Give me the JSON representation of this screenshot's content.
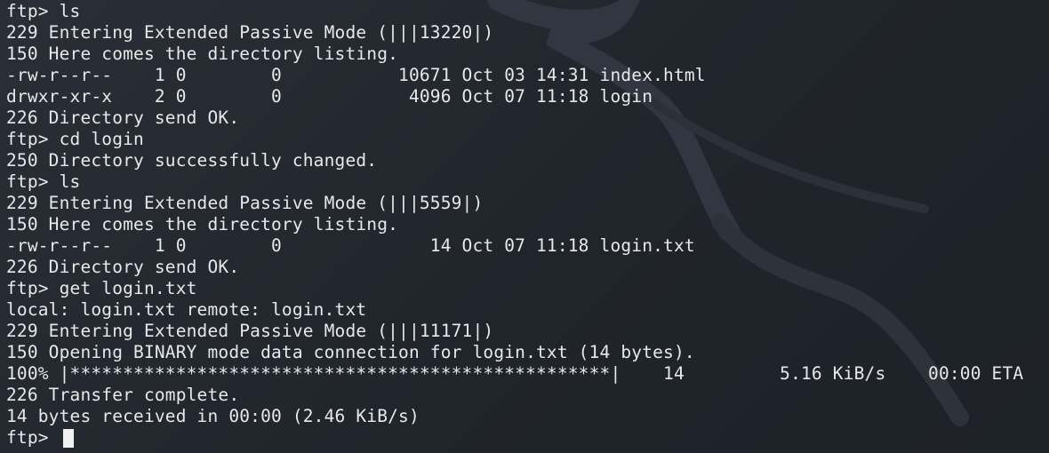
{
  "terminal": {
    "lines": [
      "ftp> ls",
      "229 Entering Extended Passive Mode (|||13220|)",
      "150 Here comes the directory listing.",
      "-rw-r--r--    1 0        0           10671 Oct 03 14:31 index.html",
      "drwxr-xr-x    2 0        0            4096 Oct 07 11:18 login",
      "226 Directory send OK.",
      "ftp> cd login",
      "250 Directory successfully changed.",
      "ftp> ls",
      "229 Entering Extended Passive Mode (|||5559|)",
      "150 Here comes the directory listing.",
      "-rw-r--r--    1 0        0              14 Oct 07 11:18 login.txt",
      "226 Directory send OK.",
      "ftp> get login.txt",
      "local: login.txt remote: login.txt",
      "229 Entering Extended Passive Mode (|||11171|)",
      "150 Opening BINARY mode data connection for login.txt (14 bytes).",
      "100% |***************************************************|    14         5.16 KiB/s    00:00 ETA",
      "226 Transfer complete.",
      "14 bytes received in 00:00 (2.46 KiB/s)"
    ],
    "prompt": "ftp> ",
    "colors": {
      "background": "#23272f",
      "text": "#e8e8e8",
      "cursor": "#f1f1f1"
    }
  }
}
